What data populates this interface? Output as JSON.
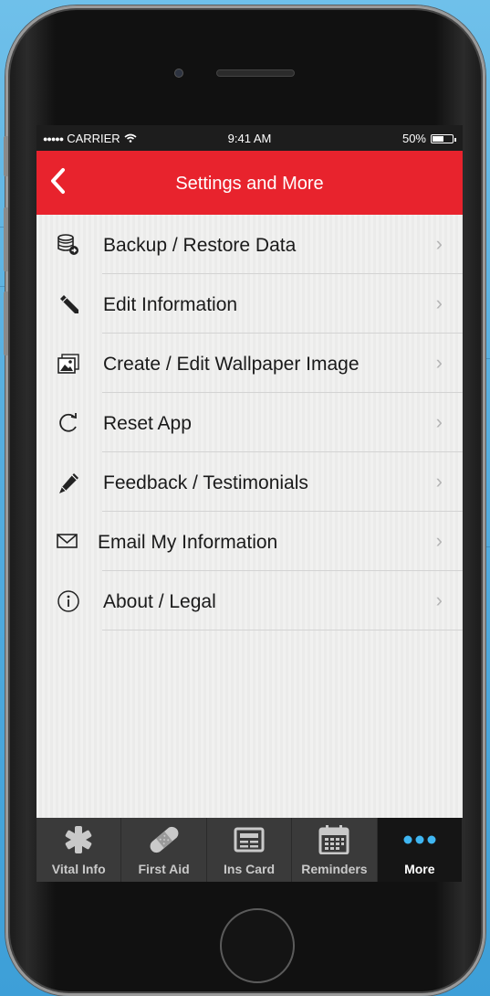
{
  "status_bar": {
    "carrier": "CARRIER",
    "time": "9:41 AM",
    "battery": "50%"
  },
  "nav": {
    "title": "Settings and More",
    "back_icon": "chevron-left-icon"
  },
  "menu": {
    "items": [
      {
        "label": "Backup / Restore Data",
        "icon": "database-restore-icon"
      },
      {
        "label": "Edit Information",
        "icon": "pencil-icon"
      },
      {
        "label": "Create / Edit Wallpaper Image",
        "icon": "image-icon"
      },
      {
        "label": "Reset App",
        "icon": "refresh-icon"
      },
      {
        "label": "Feedback / Testimonials",
        "icon": "pen-icon"
      },
      {
        "label": "Email My Information",
        "icon": "envelope-icon"
      },
      {
        "label": "About / Legal",
        "icon": "info-icon"
      }
    ]
  },
  "tabs": [
    {
      "label": "Vital Info",
      "icon": "asterisk-icon"
    },
    {
      "label": "First Aid",
      "icon": "bandage-icon"
    },
    {
      "label": "Ins Card",
      "icon": "card-icon"
    },
    {
      "label": "Reminders",
      "icon": "calendar-icon"
    },
    {
      "label": "More",
      "icon": "more-dots-icon",
      "active": true
    }
  ],
  "colors": {
    "nav_red": "#e8232d",
    "tab_bar": "#3a3a3a",
    "active_dots": "#3fb6f2"
  }
}
